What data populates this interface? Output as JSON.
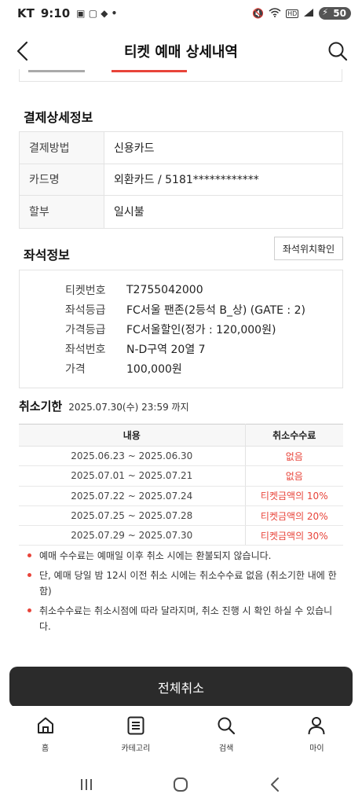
{
  "status_bar": {
    "carrier": "KT",
    "time": "9:10",
    "battery": "50"
  },
  "header": {
    "title": "티켓 예매 상세내역"
  },
  "payment": {
    "section_title": "결제상세정보",
    "rows": [
      {
        "label": "결제방법",
        "value": "신용카드"
      },
      {
        "label": "카드명",
        "value": "외환카드 / 5181************"
      },
      {
        "label": "할부",
        "value": "일시불"
      }
    ]
  },
  "seat": {
    "section_title": "좌석정보",
    "location_button": "좌석위치확인",
    "rows": [
      {
        "label": "티켓번호",
        "value": "T2755042000"
      },
      {
        "label": "좌석등급",
        "value": "FC서울 팬존(2등석 B_상) (GATE : 2)"
      },
      {
        "label": "가격등급",
        "value": "FC서울할인(정가 : 120,000원)"
      },
      {
        "label": "좌석번호",
        "value": "N-D구역 20열 7"
      },
      {
        "label": "가격",
        "value": "100,000원"
      }
    ]
  },
  "cancel_deadline": {
    "title": "취소기한",
    "value": "2025.07.30(수) 23:59 까지"
  },
  "fee_table": {
    "headers": [
      "내용",
      "취소수수료"
    ],
    "rows": [
      {
        "period": "2025.06.23 ~ 2025.06.30",
        "fee": "없음"
      },
      {
        "period": "2025.07.01 ~ 2025.07.21",
        "fee": "없음"
      },
      {
        "period": "2025.07.22 ~ 2025.07.24",
        "fee": "티켓금액의 10%"
      },
      {
        "period": "2025.07.25 ~ 2025.07.28",
        "fee": "티켓금액의 20%"
      },
      {
        "period": "2025.07.29 ~ 2025.07.30",
        "fee": "티켓금액의 30%"
      }
    ]
  },
  "notes": [
    "예매 수수료는 예매일 이후 취소 시에는 환불되지 않습니다.",
    "단, 예매 당일 밤 12시 이전 취소 시에는 취소수수료 없음 (취소기한 내에 한함)",
    "취소수수료는 취소시점에 따라 달라지며, 취소 진행 시 확인 하실 수 있습니다."
  ],
  "cancel_all_button": "전체취소",
  "bottom_nav": [
    {
      "label": "홈",
      "icon": "home-icon"
    },
    {
      "label": "카테고리",
      "icon": "category-list-icon"
    },
    {
      "label": "검색",
      "icon": "search-icon"
    },
    {
      "label": "마이",
      "icon": "person-icon"
    }
  ],
  "colors": {
    "accent_red": "#e8443a",
    "button_dark": "#2b2b2b"
  }
}
